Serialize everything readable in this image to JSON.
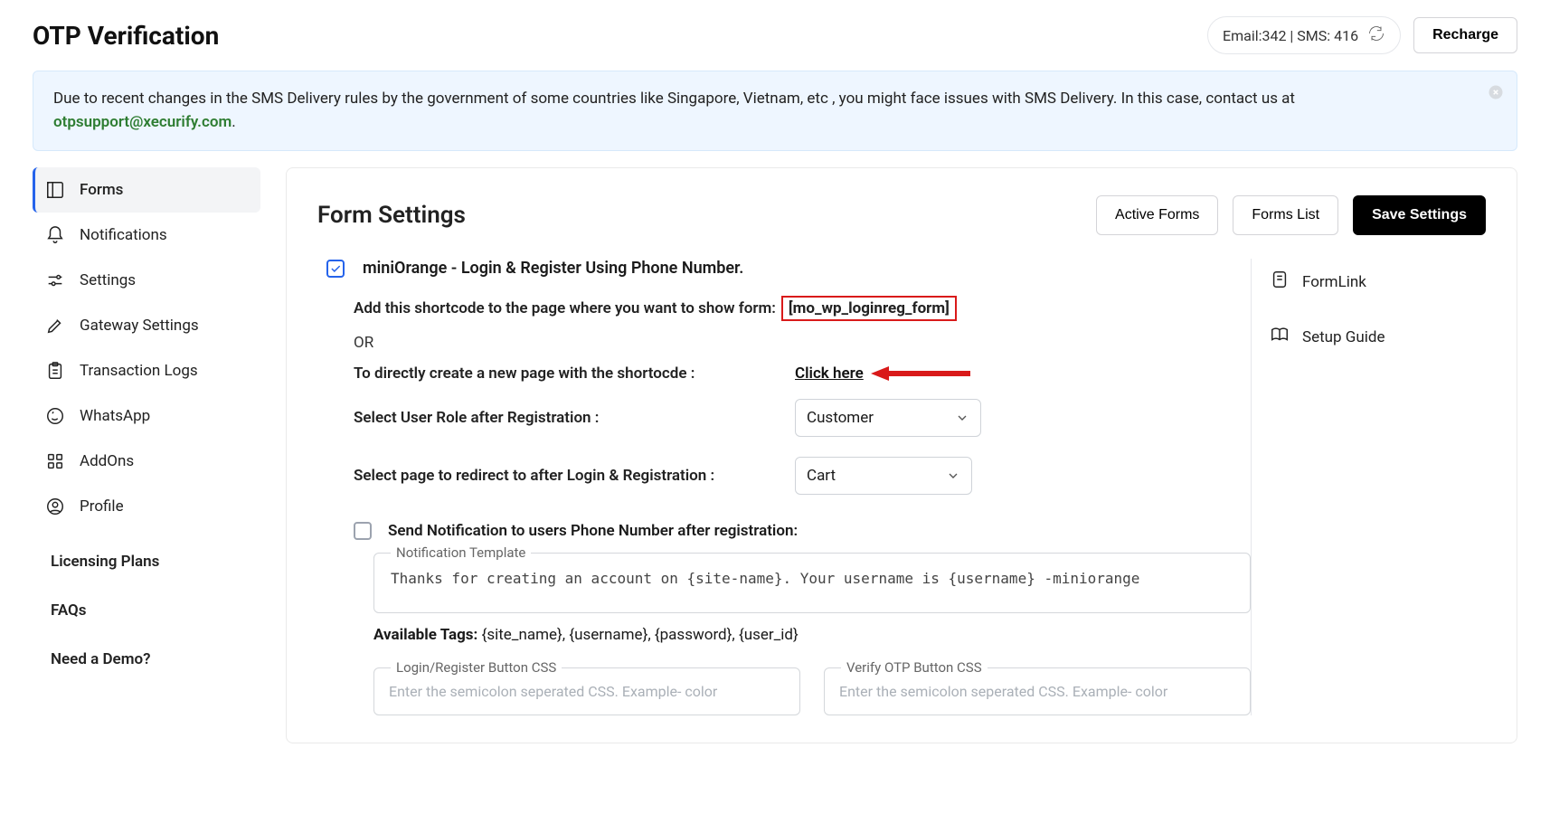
{
  "header": {
    "title": "OTP Verification",
    "quota": "Email:342 | SMS: 416",
    "recharge": "Recharge"
  },
  "notice": {
    "text": "Due to recent changes in the SMS Delivery rules by the government of some countries like Singapore, Vietnam, etc , you might face issues with SMS Delivery. In this case, contact us at ",
    "email": "otpsupport@xecurify.com",
    "period": "."
  },
  "sidebar": {
    "items": [
      {
        "label": "Forms"
      },
      {
        "label": "Notifications"
      },
      {
        "label": "Settings"
      },
      {
        "label": "Gateway Settings"
      },
      {
        "label": "Transaction Logs"
      },
      {
        "label": "WhatsApp"
      },
      {
        "label": "AddOns"
      },
      {
        "label": "Profile"
      }
    ],
    "simple": [
      {
        "label": "Licensing Plans"
      },
      {
        "label": "FAQs"
      },
      {
        "label": "Need a Demo?"
      }
    ]
  },
  "main": {
    "heading": "Form Settings",
    "actions": {
      "active": "Active Forms",
      "list": "Forms List",
      "save": "Save Settings"
    },
    "form_title": "miniOrange - Login & Register Using Phone Number.",
    "shortcode_label": "Add this shortcode to the page where you want to show form:",
    "shortcode_value": "[mo_wp_loginreg_form]",
    "or": "OR",
    "create_page_label": "To directly create a new page with the shortocde :",
    "click_here": "Click here",
    "role_label": "Select User Role after Registration :",
    "role_value": "Customer",
    "redirect_label": "Select page to redirect to after Login & Registration :",
    "redirect_value": "Cart",
    "notify_label": "Send Notification to users Phone Number after registration:",
    "template_legend": "Notification Template",
    "template_value": "Thanks for creating an account on {site-name}. Your username is {username} -miniorange",
    "tags_label": "Available Tags: ",
    "tags_value": "{site_name}, {username}, {password}, {user_id}",
    "css1_legend": "Login/Register Button CSS",
    "css2_legend": "Verify OTP Button CSS",
    "css_placeholder": "Enter the semicolon seperated CSS. Example- color",
    "right": {
      "formlink": "FormLink",
      "guide": "Setup Guide"
    }
  }
}
